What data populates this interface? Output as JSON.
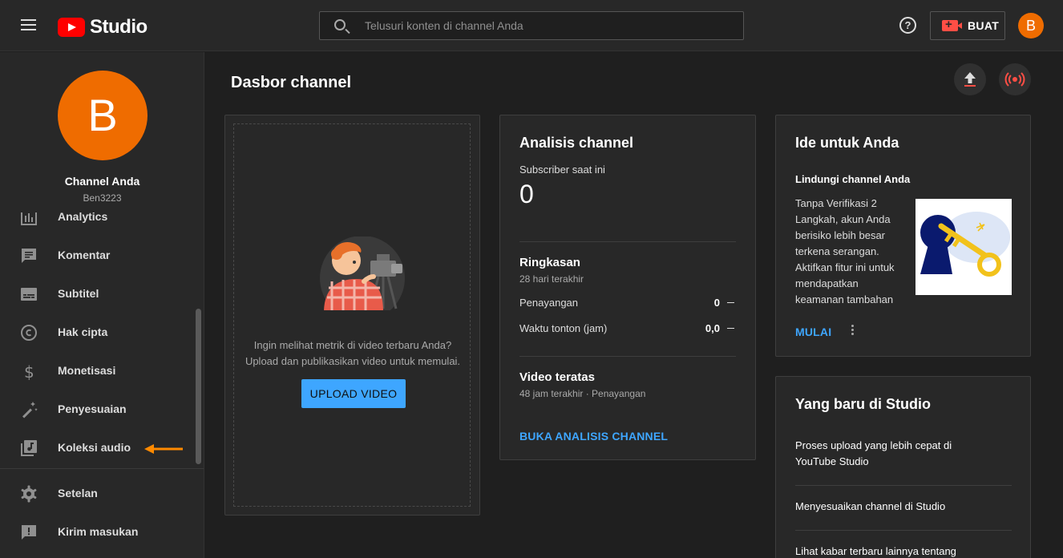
{
  "topbar": {
    "logo_text": "Studio",
    "search_placeholder": "Telusuri konten di channel Anda",
    "help_symbol": "?",
    "create_label": "BUAT",
    "avatar_letter": "B"
  },
  "sidebar": {
    "avatar_letter": "B",
    "channel_name": "Channel Anda",
    "channel_handle": "Ben3223",
    "items": [
      {
        "label": "Analytics"
      },
      {
        "label": "Komentar"
      },
      {
        "label": "Subtitel"
      },
      {
        "label": "Hak cipta"
      },
      {
        "label": "Monetisasi"
      },
      {
        "label": "Penyesuaian"
      },
      {
        "label": "Koleksi audio"
      },
      {
        "label": "Setelan"
      },
      {
        "label": "Kirim masukan"
      }
    ],
    "arrow_color": "#ff8a00"
  },
  "main": {
    "title": "Dasbor channel",
    "upload_card": {
      "text_line1": "Ingin melihat metrik di video terbaru Anda?",
      "text_line2": "Upload dan publikasikan video untuk memulai.",
      "button_label": "UPLOAD VIDEO"
    },
    "analytics_card": {
      "title": "Analisis channel",
      "subscribers_label": "Subscriber saat ini",
      "subscribers_value": "0",
      "summary_title": "Ringkasan",
      "summary_period": "28 hari terakhir",
      "metrics": [
        {
          "label": "Penayangan",
          "value": "0"
        },
        {
          "label": "Waktu tonton (jam)",
          "value": "0,0"
        }
      ],
      "top_videos_title": "Video teratas",
      "top_videos_period": "48 jam terakhir · Penayangan",
      "link_label": "BUKA ANALISIS CHANNEL"
    },
    "ideas_card": {
      "title": "Ide untuk Anda",
      "subtitle": "Lindungi channel Anda",
      "body_lines": [
        "Tanpa Verifikasi 2",
        "Langkah, akun Anda",
        "berisiko lebih besar",
        "terkena serangan.",
        "Aktifkan fitur ini untuk",
        "mendapatkan",
        "keamanan tambahan"
      ],
      "action_label": "MULAI"
    },
    "news_card": {
      "title": "Yang baru di Studio",
      "items": [
        {
          "line1": "Proses upload yang lebih cepat di",
          "line2": "YouTube Studio"
        },
        {
          "line1": "Menyesuaikan channel di Studio",
          "line2": ""
        },
        {
          "line1": "Lihat kabar terbaru lainnya tentang",
          "line2": ""
        }
      ]
    }
  },
  "colors": {
    "accent_blue": "#3ea6ff",
    "brand_red": "#ff0000",
    "avatar_orange": "#ef6c00"
  }
}
